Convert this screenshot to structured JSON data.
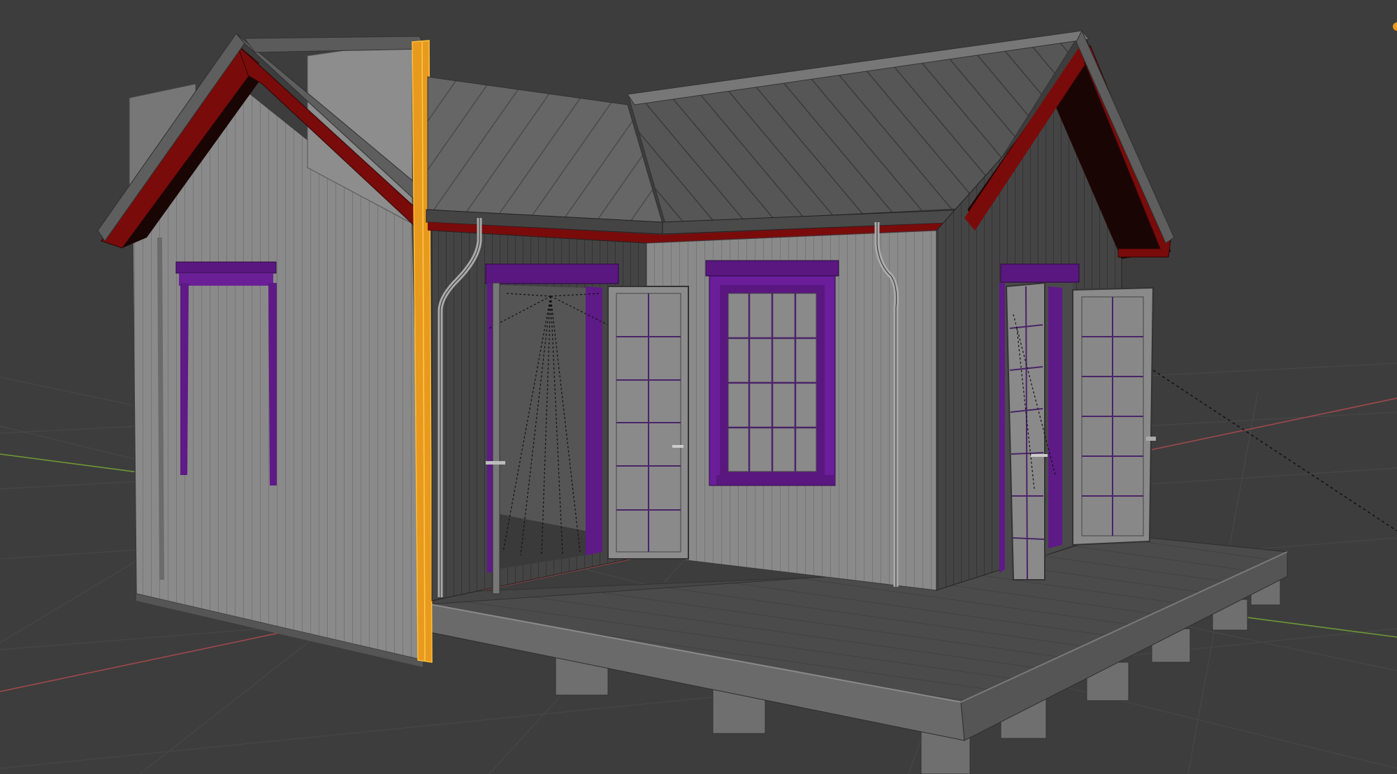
{
  "viewport": {
    "background": "#3d3d3d",
    "grid_color": "#474747",
    "axis_x_color": "#a0484c",
    "axis_y_color": "#6f9a35",
    "selection_color": "#f0a020"
  },
  "scene": {
    "wall_color": "#8c8c8c",
    "wall_shadow_color": "#4a4a4a",
    "roof_color": "#6a6a6a",
    "fascia_color": "#8a1010",
    "trim_color": "#5e1a86",
    "deck_color": "#505050"
  },
  "icons": [
    "orange-dot-icon"
  ]
}
